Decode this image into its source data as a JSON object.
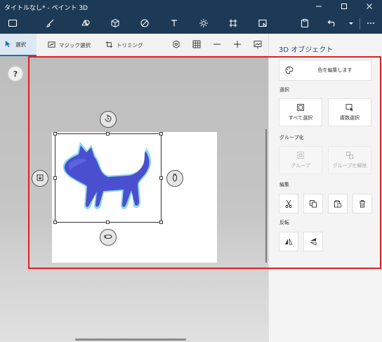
{
  "window": {
    "title": "タイトルなし* - ペイント 3D",
    "minimize_icon": "minimize-icon",
    "maximize_icon": "maximize-icon",
    "close_icon": "close-icon"
  },
  "toolbar": {
    "icons": [
      "menu-icon",
      "brush-icon",
      "2d-shapes-icon",
      "3d-shapes-icon",
      "stickers-icon",
      "text-icon",
      "effects-icon",
      "canvas-icon",
      "3d-library-icon",
      "paste-icon",
      "undo-icon",
      "history-dropdown-icon",
      "more-icon"
    ]
  },
  "subtoolbar": {
    "select_label": "選択",
    "magic_select_label": "マジック選択",
    "crop_label": "トリミング",
    "icons": [
      "3d-view-icon",
      "grid-icon",
      "zoom-out-icon",
      "zoom-in-icon",
      "image-options-icon"
    ]
  },
  "help": {
    "label": "?"
  },
  "panel": {
    "title": "3D オブジェクト",
    "edit_color_label": "色を編集します",
    "select_section": "選択",
    "select_all_label": "すべて選択",
    "multi_select_label": "複数選択",
    "group_section": "グループ化",
    "group_label": "グループ",
    "ungroup_label": "グループを解除",
    "edit_section": "編集",
    "flip_section": "反転"
  },
  "colors": {
    "titlebar": "#1c3a55",
    "accent": "#1f6fbf",
    "highlight_frame": "#e02020",
    "cat_body": "#4a4fd0",
    "cat_glow": "#8ad8f0"
  }
}
